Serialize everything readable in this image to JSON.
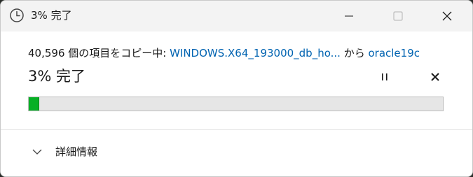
{
  "window": {
    "title": "3% 完了",
    "icon": "clock-icon"
  },
  "copy": {
    "prefix": "40,596 個の項目をコピー中: ",
    "source": "WINDOWS.X64_193000_db_ho...",
    "middle": " から ",
    "destination": "oracle19c",
    "percent_label": "3% 完了",
    "progress_percent": 3
  },
  "controls": {
    "pause_icon": "pause-icon",
    "stop_icon": "close-icon"
  },
  "details": {
    "label": "詳細情報",
    "icon": "chevron-down-icon"
  },
  "colors": {
    "progress": "#06b025",
    "link": "#0063b1",
    "track": "#e6e6e6"
  }
}
